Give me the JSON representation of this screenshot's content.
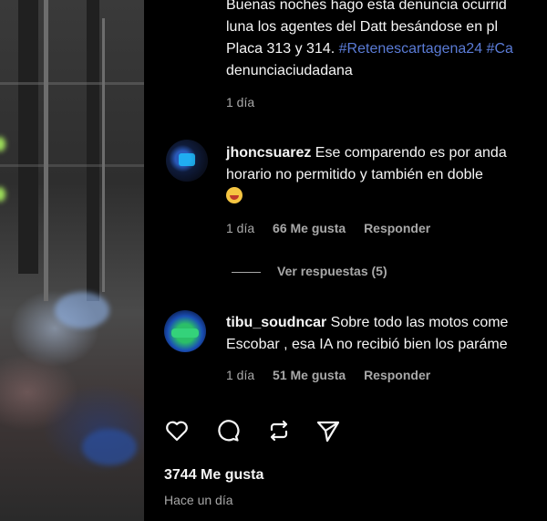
{
  "caption": {
    "line1": "Buenas noches hago esta denuncia ocurrid",
    "line2": "luna los agentes del Datt besándose en pl",
    "line3_text": "Placa 313 y 314. ",
    "line3_tag1": "#Retenescartagena24",
    "line3_tag2": " #Ca",
    "line4": "denunciaciudadana",
    "time": "1 día"
  },
  "comments": [
    {
      "username": "jhoncsuarez",
      "text_line1": " Ese comparendo es por anda",
      "text_line2": "horario no permitido y también en doble",
      "has_emoji": true,
      "time": "1 día",
      "likes": "66 Me gusta",
      "reply": "Responder"
    },
    {
      "username": "tibu_soudncar",
      "text_line1": " Sobre todo las motos come",
      "text_line2": "Escobar , esa IA no recibió bien los paráme",
      "time": "1 día",
      "likes": "51 Me gusta",
      "reply": "Responder"
    }
  ],
  "view_replies": "Ver respuestas (5)",
  "actions": {
    "icons": [
      "heart-icon",
      "comment-icon",
      "repost-icon",
      "share-icon"
    ]
  },
  "post": {
    "likes": "3744 Me gusta",
    "time": "Hace un día"
  },
  "colors": {
    "background": "#000000",
    "text": "#f5f5f5",
    "muted": "#a8a8a8",
    "hashtag": "#5a7bd6"
  }
}
